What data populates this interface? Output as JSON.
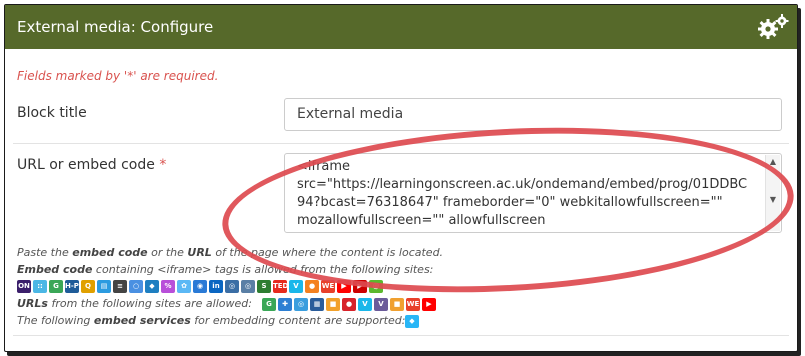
{
  "header": {
    "title": "External media: Configure",
    "icon": "gears-icon",
    "color": "#56692a"
  },
  "form": {
    "required_note": "Fields marked by '*' are required.",
    "block_title": {
      "label": "Block title",
      "value": "External media"
    },
    "url": {
      "label": "URL or embed code",
      "required_mark": "*",
      "lines": [
        "<iframe",
        "src=\"https://learningonscreen.ac.uk/ondemand/embed/prog/01DDBC",
        "94?bcast=76318647\" frameborder=\"0\" webkitallowfullscreen=\"\"",
        "mozallowfullscreen=\"\" allowfullscreen"
      ]
    }
  },
  "help": {
    "line1_a": "Paste the ",
    "line1_b": "embed code",
    "line1_c": " or the ",
    "line1_d": "URL",
    "line1_e": " of the page where the content is located.",
    "line2_a": "Embed code",
    "line2_b": " containing <iframe> tags is allowed from the following sites:",
    "line3_a": "URLs",
    "line3_b": " from the following sites are allowed:",
    "line4_a": "The following ",
    "line4_b": "embed services",
    "line4_c": " for embedding content are supported:"
  },
  "site_icons_iframe": [
    {
      "name": "on-icon",
      "text": "ON",
      "color": "#3b1f6b"
    },
    {
      "name": "dots-icon",
      "text": "::",
      "color": "#4bb7e5"
    },
    {
      "name": "g-icon",
      "text": "G",
      "color": "#3aa757"
    },
    {
      "name": "h5p-icon",
      "text": "H-P",
      "color": "#1f5c99"
    },
    {
      "name": "search-icon",
      "text": "Q",
      "color": "#e0a000"
    },
    {
      "name": "chart-icon",
      "text": "▤",
      "color": "#2b9be0"
    },
    {
      "name": "stack-icon",
      "text": "≡",
      "color": "#444444"
    },
    {
      "name": "circle-icon",
      "text": "○",
      "color": "#4a90e2"
    },
    {
      "name": "box-icon",
      "text": "◆",
      "color": "#1e7fc1"
    },
    {
      "name": "brush-icon",
      "text": "%",
      "color": "#b84fd9"
    },
    {
      "name": "flower-icon",
      "text": "✿",
      "color": "#5bb8f5"
    },
    {
      "name": "target-icon",
      "text": "◉",
      "color": "#2a7ad6"
    },
    {
      "name": "linkedin-icon",
      "text": "in",
      "color": "#0a66c2"
    },
    {
      "name": "globe-icon",
      "text": "◎",
      "color": "#3b6ea5"
    },
    {
      "name": "globe2-icon",
      "text": "◎",
      "color": "#5a7fa5"
    },
    {
      "name": "slides-icon",
      "text": "S",
      "color": "#2e7d32"
    },
    {
      "name": "ted-icon",
      "text": "TED",
      "color": "#e62b1e"
    },
    {
      "name": "vimeo-icon",
      "text": "V",
      "color": "#1ab7ea"
    },
    {
      "name": "chat-icon",
      "text": "●",
      "color": "#f48120"
    },
    {
      "name": "we-icon",
      "text": "WE",
      "color": "#e8402a"
    },
    {
      "name": "youtube-icon",
      "text": "▶",
      "color": "#ff0000"
    },
    {
      "name": "youtube2-icon",
      "text": "▶",
      "color": "#cc0000"
    },
    {
      "name": "swirl-icon",
      "text": "@",
      "color": "#5cb82e"
    }
  ],
  "site_icons_url": [
    {
      "name": "g-icon",
      "text": "G",
      "color": "#3aa757"
    },
    {
      "name": "puzzle-icon",
      "text": "✚",
      "color": "#2d7fd3"
    },
    {
      "name": "circle-icon",
      "text": "◎",
      "color": "#3b9ede"
    },
    {
      "name": "map-icon",
      "text": "▦",
      "color": "#2a5c9a"
    },
    {
      "name": "square-icon",
      "text": "■",
      "color": "#f2a12b"
    },
    {
      "name": "apple-icon",
      "text": "●",
      "color": "#d8232a"
    },
    {
      "name": "vimeo-icon",
      "text": "V",
      "color": "#1ab7ea"
    },
    {
      "name": "v-icon",
      "text": "V",
      "color": "#6b5b9a"
    },
    {
      "name": "orange-icon",
      "text": "■",
      "color": "#f0a030"
    },
    {
      "name": "we-icon",
      "text": "WE",
      "color": "#e8402a"
    },
    {
      "name": "youtube-icon",
      "text": "▶",
      "color": "#ff0000"
    }
  ],
  "embed_service_icon": {
    "name": "diamond-icon",
    "text": "◆",
    "color": "#29b6f6"
  }
}
